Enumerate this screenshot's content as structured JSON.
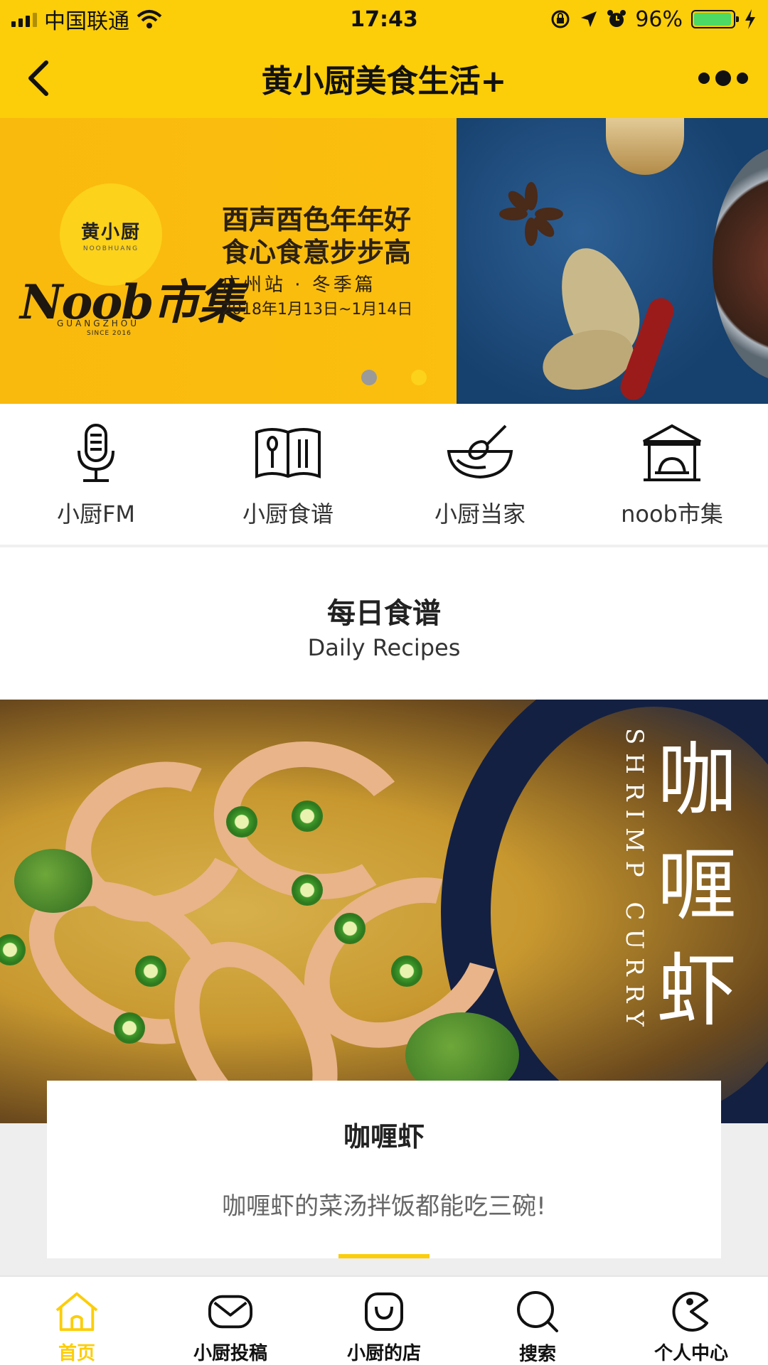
{
  "status_bar": {
    "carrier": "中国联通",
    "time": "17:43",
    "battery_percent": "96%",
    "battery_level": 0.96,
    "icons": [
      "signal-icon",
      "wifi-icon",
      "rotation-lock-icon",
      "location-icon",
      "alarm-icon",
      "battery-icon",
      "charging-icon"
    ]
  },
  "nav": {
    "title": "黄小厨美食生活+",
    "back_icon": "back-chevron-icon",
    "more_icon": "more-dots-icon"
  },
  "banner": {
    "logo_cn": "黄小厨",
    "logo_en": "NOOBHUANG",
    "script_title": "Noob市集",
    "city_en": "GUANGZHOU",
    "since": "SINCE 2016",
    "line1": "酉声酉色年年好",
    "line2": "食心食意步步高",
    "line3": "广州站 · 冬季篇",
    "line4": "2018年1月13日~1月14日",
    "page_count": 2,
    "active_page": 2
  },
  "quick_nav": [
    {
      "label": "小厨FM",
      "icon": "microphone-icon"
    },
    {
      "label": "小厨食谱",
      "icon": "recipe-book-icon"
    },
    {
      "label": "小厨当家",
      "icon": "mixing-bowl-icon"
    },
    {
      "label": "noob市集",
      "icon": "market-stall-icon"
    }
  ],
  "section": {
    "title": "每日食谱",
    "subtitle": "Daily Recipes"
  },
  "recipe": {
    "image_title_cn": "咖喱虾",
    "image_title_en": "SHRIMP CURRY",
    "title": "咖喱虾",
    "description": "咖喱虾的菜汤拌饭都能吃三碗!"
  },
  "tab_bar": [
    {
      "label": "首页",
      "icon": "home-icon",
      "active": true
    },
    {
      "label": "小厨投稿",
      "icon": "envelope-icon",
      "active": false
    },
    {
      "label": "小厨的店",
      "icon": "shop-bag-icon",
      "active": false
    },
    {
      "label": "搜索",
      "icon": "search-icon",
      "active": false
    },
    {
      "label": "个人中心",
      "icon": "profile-pacman-icon",
      "active": false
    }
  ],
  "colors": {
    "accent": "#fccd09",
    "banner_bg": "#f9b90d",
    "text_dark": "#222222",
    "text_muted": "#666666",
    "battery_green": "#4cd964"
  }
}
